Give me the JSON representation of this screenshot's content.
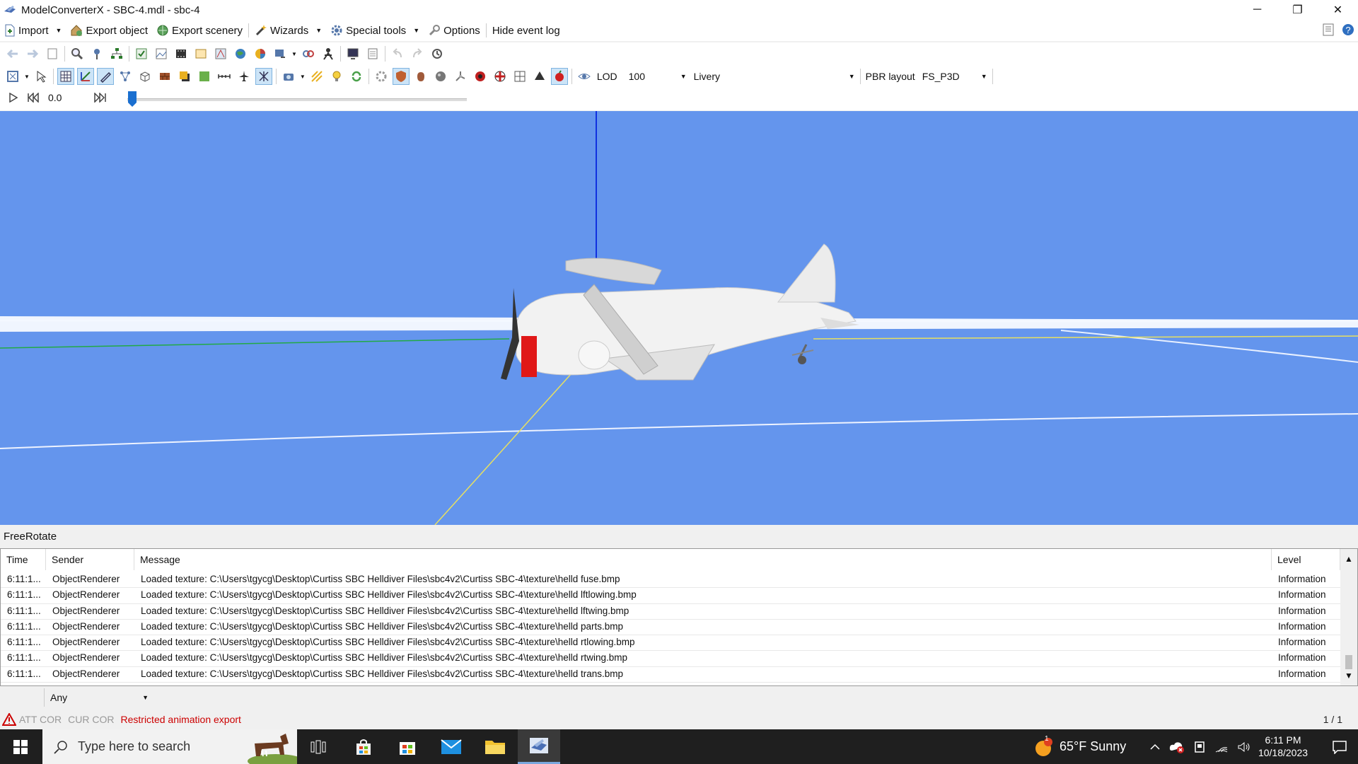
{
  "window": {
    "title": "ModelConverterX - SBC-4.mdl - sbc-4",
    "minimize": "─",
    "restore": "❐",
    "close": "✕"
  },
  "menu": {
    "import": "Import",
    "export_object": "Export object",
    "export_scenery": "Export scenery",
    "wizards": "Wizards",
    "special_tools": "Special tools",
    "options": "Options",
    "hide_event_log": "Hide event log"
  },
  "toolbar2": {
    "lod_label": "LOD",
    "lod_value": "100",
    "livery_label": "Livery",
    "pbr_label": "PBR layout",
    "pbr_value": "FS_P3D"
  },
  "animation": {
    "time_value": "0.0",
    "progress": 0
  },
  "viewport": {
    "mode": "FreeRotate",
    "background_color": "#6495ed"
  },
  "event_log": {
    "columns": {
      "time": "Time",
      "sender": "Sender",
      "message": "Message",
      "level": "Level"
    },
    "rows": [
      {
        "time": "6:11:1...",
        "sender": "ObjectRenderer",
        "message": "Loaded texture: C:\\Users\\tgycg\\Desktop\\Curtiss SBC Helldiver Files\\sbc4v2\\Curtiss SBC-4\\texture\\helld fuse.bmp",
        "level": "Information"
      },
      {
        "time": "6:11:1...",
        "sender": "ObjectRenderer",
        "message": "Loaded texture: C:\\Users\\tgycg\\Desktop\\Curtiss SBC Helldiver Files\\sbc4v2\\Curtiss SBC-4\\texture\\helld lftlowing.bmp",
        "level": "Information"
      },
      {
        "time": "6:11:1...",
        "sender": "ObjectRenderer",
        "message": "Loaded texture: C:\\Users\\tgycg\\Desktop\\Curtiss SBC Helldiver Files\\sbc4v2\\Curtiss SBC-4\\texture\\helld lftwing.bmp",
        "level": "Information"
      },
      {
        "time": "6:11:1...",
        "sender": "ObjectRenderer",
        "message": "Loaded texture: C:\\Users\\tgycg\\Desktop\\Curtiss SBC Helldiver Files\\sbc4v2\\Curtiss SBC-4\\texture\\helld parts.bmp",
        "level": "Information"
      },
      {
        "time": "6:11:1...",
        "sender": "ObjectRenderer",
        "message": "Loaded texture: C:\\Users\\tgycg\\Desktop\\Curtiss SBC Helldiver Files\\sbc4v2\\Curtiss SBC-4\\texture\\helld rtlowing.bmp",
        "level": "Information"
      },
      {
        "time": "6:11:1...",
        "sender": "ObjectRenderer",
        "message": "Loaded texture: C:\\Users\\tgycg\\Desktop\\Curtiss SBC Helldiver Files\\sbc4v2\\Curtiss SBC-4\\texture\\helld rtwing.bmp",
        "level": "Information"
      },
      {
        "time": "6:11:1...",
        "sender": "ObjectRenderer",
        "message": "Loaded texture: C:\\Users\\tgycg\\Desktop\\Curtiss SBC Helldiver Files\\sbc4v2\\Curtiss SBC-4\\texture\\helld trans.bmp",
        "level": "Information"
      }
    ],
    "filter_value": "Any"
  },
  "status": {
    "att_cor": "ATT COR",
    "cur_cor": "CUR COR",
    "warning": "Restricted animation export",
    "page_info": "1 / 1"
  },
  "taskbar": {
    "search_placeholder": "Type here to search",
    "weather": "65°F  Sunny",
    "time": "6:11 PM",
    "date": "10/18/2023",
    "notification_badge": "1"
  }
}
